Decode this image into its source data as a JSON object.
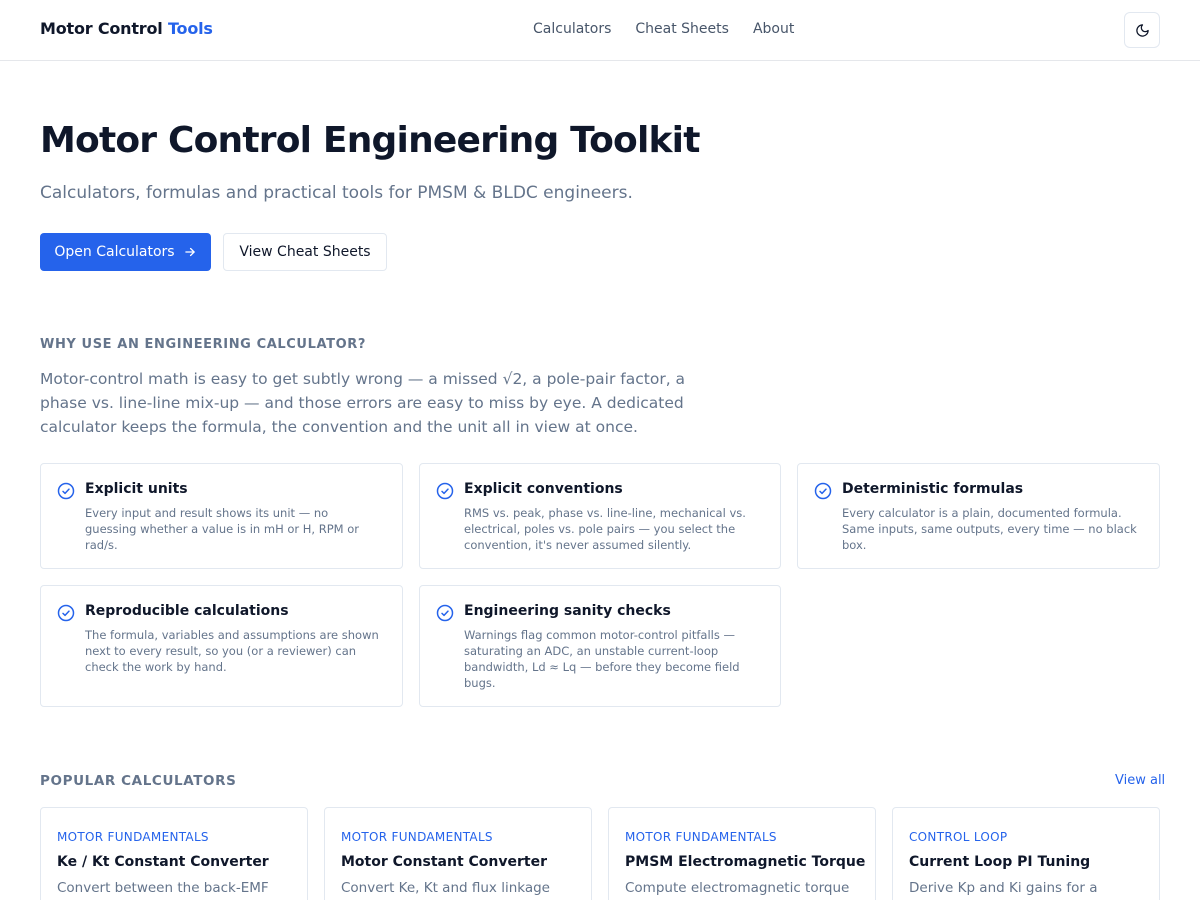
{
  "header": {
    "brand_main": "Motor Control",
    "brand_accent": "Tools",
    "nav": [
      "Calculators",
      "Cheat Sheets",
      "About"
    ],
    "theme_icon": "moon-icon"
  },
  "hero": {
    "title": "Motor Control Engineering Toolkit",
    "subtitle": "Calculators, formulas and practical tools for PMSM & BLDC engineers.",
    "primary_button": "Open Calculators",
    "secondary_button": "View Cheat Sheets"
  },
  "why": {
    "heading": "Why use an engineering calculator?",
    "body": "Motor-control math is easy to get subtly wrong — a missed √2, a pole-pair factor, a phase vs. line-line mix-up — and those errors are easy to miss by eye. A dedicated calculator keeps the formula, the convention and the unit all in view at once.",
    "features": [
      {
        "title": "Explicit units",
        "desc": "Every input and result shows its unit — no guessing whether a value is in mH or H, RPM or rad/s."
      },
      {
        "title": "Explicit conventions",
        "desc": "RMS vs. peak, phase vs. line-line, mechanical vs. electrical, poles vs. pole pairs — you select the convention, it's never assumed silently."
      },
      {
        "title": "Deterministic formulas",
        "desc": "Every calculator is a plain, documented formula. Same inputs, same outputs, every time — no black box."
      },
      {
        "title": "Reproducible calculations",
        "desc": "The formula, variables and assumptions are shown next to every result, so you (or a reviewer) can check the work by hand."
      },
      {
        "title": "Engineering sanity checks",
        "desc": "Warnings flag common motor-control pitfalls — saturating an ADC, an unstable current-loop bandwidth, Ld ≈ Lq — before they become field bugs."
      }
    ]
  },
  "popular": {
    "heading": "Popular Calculators",
    "view_all": "View all",
    "items": [
      {
        "category": "Motor Fundamentals",
        "title": "Ke / Kt Constant Converter",
        "desc": "Convert between the back-EMF"
      },
      {
        "category": "Motor Fundamentals",
        "title": "Motor Constant Converter",
        "desc": "Convert Ke, Kt and flux linkage"
      },
      {
        "category": "Motor Fundamentals",
        "title": "PMSM Electromagnetic Torque",
        "desc": "Compute electromagnetic torque"
      },
      {
        "category": "Control Loop",
        "title": "Current Loop PI Tuning",
        "desc": "Derive Kp and Ki gains for a current"
      }
    ]
  },
  "colors": {
    "accent": "#2563eb",
    "text": "#0f172a",
    "muted": "#64748b",
    "border": "#e2e8f0"
  }
}
